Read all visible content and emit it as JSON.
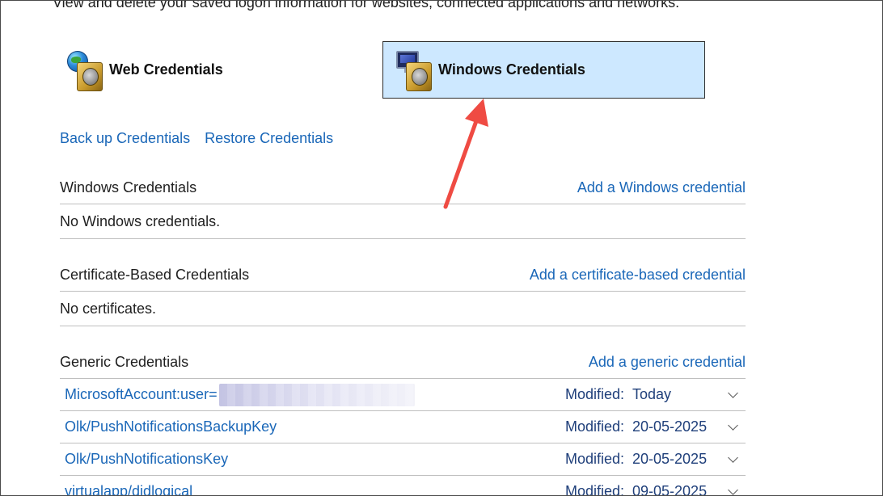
{
  "intro": {
    "text": "View and delete your saved logon information for websites, connected applications and networks."
  },
  "tiles": {
    "web_label": "Web Credentials",
    "windows_label": "Windows Credentials"
  },
  "links": {
    "backup": "Back up Credentials",
    "restore": "Restore Credentials"
  },
  "sections": {
    "windows": {
      "title": "Windows Credentials",
      "action": "Add a Windows credential",
      "body": "No Windows credentials."
    },
    "certificate": {
      "title": "Certificate-Based Credentials",
      "action": "Add a certificate-based credential",
      "body": "No certificates."
    },
    "generic": {
      "title": "Generic Credentials",
      "action": "Add a generic credential",
      "items": [
        {
          "name": "MicrosoftAccount:user=",
          "modified_label": "Modified:",
          "modified_value": "Today"
        },
        {
          "name": "Olk/PushNotificationsBackupKey",
          "modified_label": "Modified:",
          "modified_value": "20-05-2025"
        },
        {
          "name": "Olk/PushNotificationsKey",
          "modified_label": "Modified:",
          "modified_value": "20-05-2025"
        },
        {
          "name": "virtualapp/didlogical",
          "modified_label": "Modified:",
          "modified_value": "09-05-2025"
        }
      ]
    }
  },
  "colors": {
    "link": "#1a67b8",
    "selected_tile_bg": "#cde8ff",
    "annotation_arrow": "#ef4b43"
  },
  "icons": {
    "web": "vault-globe-icon",
    "windows": "vault-monitor-icon",
    "expand": "chevron-down-icon",
    "annotation": "arrow-icon"
  }
}
